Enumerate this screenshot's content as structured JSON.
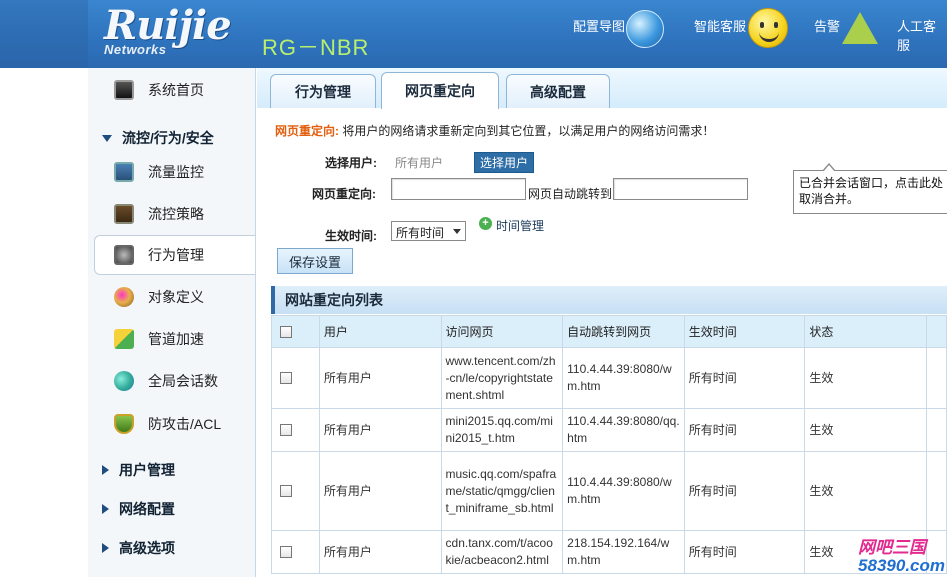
{
  "header": {
    "brand": "Ruijie",
    "brand_sub": "Networks",
    "model": "RG－NBR",
    "links": [
      "配置导图",
      "智能客服",
      "告警",
      "人工客服"
    ]
  },
  "sidebar": {
    "items": [
      {
        "label": "系统首页",
        "icon": "monitor-icon"
      },
      {
        "label": "流控/行为/安全",
        "group": true,
        "expanded": true
      },
      {
        "label": "流量监控",
        "icon": "traffic-monitor-icon"
      },
      {
        "label": "流控策略",
        "icon": "flow-policy-icon"
      },
      {
        "label": "行为管理",
        "icon": "behavior-icon",
        "active": true
      },
      {
        "label": "对象定义",
        "icon": "palette-icon"
      },
      {
        "label": "管道加速",
        "icon": "accelerate-icon"
      },
      {
        "label": "全局会话数",
        "icon": "chat-icon"
      },
      {
        "label": "防攻击/ACL",
        "icon": "shield-icon"
      },
      {
        "label": "用户管理",
        "group": true
      },
      {
        "label": "网络配置",
        "group": true
      },
      {
        "label": "高级选项",
        "group": true
      }
    ]
  },
  "tabs": [
    {
      "label": "行为管理"
    },
    {
      "label": "网页重定向",
      "active": true
    },
    {
      "label": "高级配置"
    }
  ],
  "desc": {
    "tag": "网页重定向:",
    "text": " 将用户的网络请求重新定向到其它位置，以满足用户的网络访问需求！"
  },
  "form": {
    "select_user_label": "选择用户:",
    "select_user_value": "所有用户",
    "select_user_button": "选择用户",
    "redirect_label": "网页重定向:",
    "redirect_value": "",
    "auto_jump_label": "网页自动跳转到",
    "auto_jump_value": "",
    "effective_time_label": "生效时间:",
    "effective_time_value": "所有时间",
    "time_manage_link": "时间管理",
    "save_button": "保存设置"
  },
  "tooltip": {
    "text": "已合并会话窗口，点击此处取消合并。"
  },
  "list": {
    "title": "网站重定向列表",
    "columns": [
      "",
      "用户",
      "访问网页",
      "自动跳转到网页",
      "生效时间",
      "状态",
      ""
    ],
    "rows": [
      {
        "user": "所有用户",
        "page": "www.tencent.com/zh-cn/le/copyrightstatement.shtml",
        "jump": "110.4.44.39:8080/wm.htm",
        "time": "所有时间",
        "status": "生效"
      },
      {
        "user": "所有用户",
        "page": "mini2015.qq.com/mini2015_t.htm",
        "jump": "110.4.44.39:8080/qq.htm",
        "time": "所有时间",
        "status": "生效"
      },
      {
        "user": "所有用户",
        "page": "music.qq.com/spaframe/static/qmgg/client_miniframe_sb.html",
        "jump": "110.4.44.39:8080/wm.htm",
        "time": "所有时间",
        "status": "生效"
      },
      {
        "user": "所有用户",
        "page": "cdn.tanx.com/t/acookie/acbeacon2.html",
        "jump": "218.154.192.164/wm.htm",
        "time": "所有时间",
        "status": "生效"
      }
    ]
  },
  "watermark": {
    "line1": "网吧三国",
    "line2": "58390.com"
  },
  "colors": {
    "header_bg": "#3a86cf",
    "model_text": "#b8f06e",
    "desc_tag": "#e06010",
    "button_blue": "#2e6ea7",
    "table_header": "#dbeffa"
  }
}
